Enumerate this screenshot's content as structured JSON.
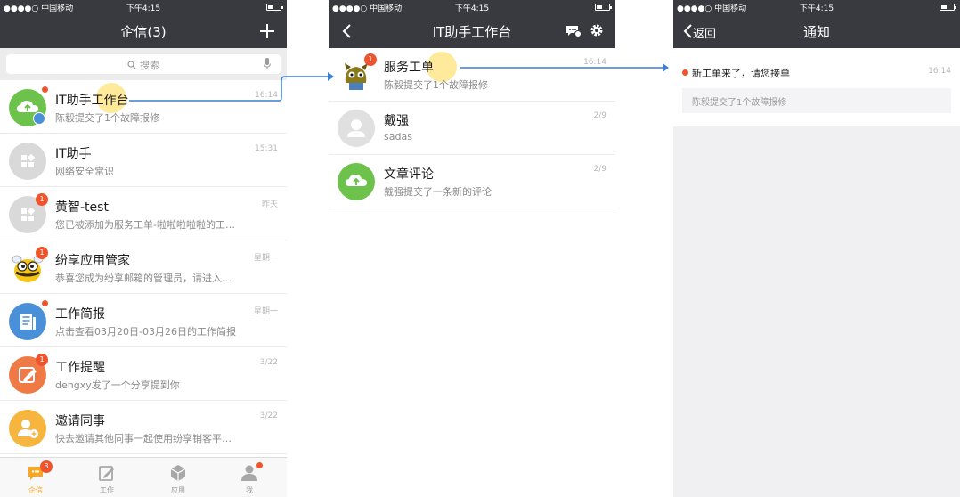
{
  "status_bar": {
    "carrier": "●●●●○ 中国移动",
    "time": "下午4:15"
  },
  "screen1": {
    "title": "企信(3)",
    "search_placeholder": "搜索",
    "conversations": [
      {
        "name": "IT助手工作台",
        "subtitle": "陈毅提交了1个故障报修",
        "time": "16:14",
        "unread": "",
        "avatar": "cloud-upload-green"
      },
      {
        "name": "IT助手",
        "subtitle": "网络安全常识",
        "time": "15:31",
        "unread": "",
        "avatar": "apps-gray"
      },
      {
        "name": "黄智-test",
        "subtitle": "您已被添加为服务工单-啦啦啦啦啦的工…",
        "time": "昨天",
        "unread": "1",
        "avatar": "apps-gray"
      },
      {
        "name": "纷享应用管家",
        "subtitle": "恭喜您成为纷享邮箱的管理员，请进入…",
        "time": "星期一",
        "unread": "1",
        "avatar": "bee-mascot"
      },
      {
        "name": "工作简报",
        "subtitle": "点击查看03月20日-03月26日的工作简报",
        "time": "星期一",
        "unread": "",
        "avatar": "report-blue"
      },
      {
        "name": "工作提醒",
        "subtitle": "dengxy发了一个分享提到你",
        "time": "3/22",
        "unread": "1",
        "avatar": "edit-orange"
      },
      {
        "name": "邀请同事",
        "subtitle": "快去邀请其他同事一起使用纷享销客平…",
        "time": "3/22",
        "unread": "",
        "avatar": "add-user-yellow"
      }
    ],
    "tabs": [
      {
        "label": "企信",
        "badge": "3"
      },
      {
        "label": "工作",
        "badge": ""
      },
      {
        "label": "应用",
        "badge": ""
      },
      {
        "label": "我",
        "badge": ""
      }
    ]
  },
  "screen2": {
    "title": "IT助手工作台",
    "items": [
      {
        "name": "服务工单",
        "subtitle": "陈毅提交了1个故障报修",
        "time": "16:14",
        "unread": "1",
        "avatar": "monster-mascot"
      },
      {
        "name": "戴强",
        "subtitle": "sadas",
        "time": "2/9",
        "unread": "",
        "avatar": "person-gray"
      },
      {
        "name": "文章评论",
        "subtitle": "戴强提交了一条新的评论",
        "time": "2/9",
        "unread": "",
        "avatar": "cloud-upload-green"
      }
    ]
  },
  "screen3": {
    "back_label": "返回",
    "title": "通知",
    "notice_title": "新工单来了，请您接单",
    "notice_time": "16:14",
    "notice_body": "陈毅提交了1个故障报修"
  },
  "colors": {
    "navbar": "#393a3f",
    "badge": "#f0542c",
    "arrow": "#3a7fd0",
    "tab_active": "#f5a623",
    "green": "#6cc24a",
    "blue": "#4a90d9",
    "orange": "#f07a46",
    "yellow": "#f5b53f",
    "gray_avatar": "#d9d9d9"
  }
}
